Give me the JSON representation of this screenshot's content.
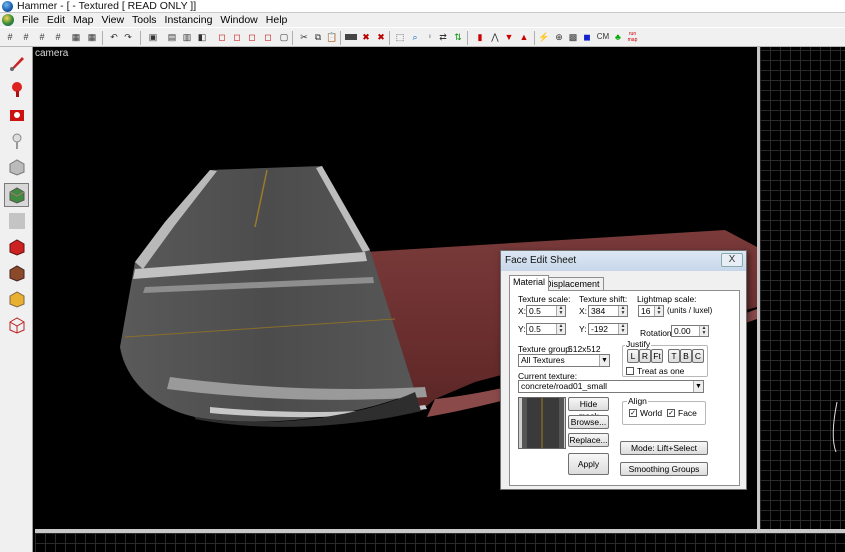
{
  "window": {
    "title": "Hammer - [ - Textured [ READ ONLY ]]"
  },
  "menu": [
    "File",
    "Edit",
    "Map",
    "View",
    "Tools",
    "Instancing",
    "Window",
    "Help"
  ],
  "toolbar": {
    "cm_label": "CM",
    "run_label": "run map"
  },
  "viewport": {
    "label": "camera"
  },
  "face_edit": {
    "title": "Face Edit Sheet",
    "close": "X",
    "tabs": [
      "Material",
      "Displacement"
    ],
    "texture_scale_label": "Texture scale:",
    "texture_shift_label": "Texture shift:",
    "lightmap_scale_label": "Lightmap scale:",
    "x_label": "X:",
    "y_label": "Y:",
    "scale_x": "0.5",
    "scale_y": "0.5",
    "shift_x": "384",
    "shift_y": "-192",
    "lightmap_value": "16",
    "lightmap_units": "(units / luxel)",
    "rotation_label": "Rotation:",
    "rotation_value": "0.00",
    "justify_label": "Justify",
    "justify_buttons": [
      "L",
      "R",
      "Ft",
      "T",
      "B",
      "C"
    ],
    "treat_as_one": "Treat as one",
    "texture_group_label": "Texture group:",
    "texture_size": "512x512",
    "texture_group_value": "All Textures",
    "current_texture_label": "Current texture:",
    "current_texture_value": "concrete/road01_small",
    "hide_mask": "Hide mask",
    "browse": "Browse...",
    "replace": "Replace...",
    "apply": "Apply",
    "align_label": "Align",
    "align_world": "World",
    "align_face": "Face",
    "mode": "Mode: Lift+Select",
    "smoothing_groups": "Smoothing Groups"
  }
}
